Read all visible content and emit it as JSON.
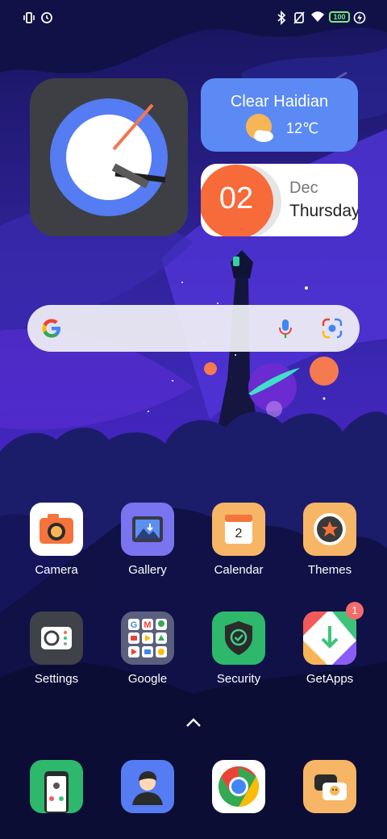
{
  "status_bar": {
    "icons": [
      "vibrate-icon",
      "alarm-icon",
      "bluetooth-icon",
      "no-sim-icon",
      "wifi-icon",
      "battery-icon",
      "charging-icon"
    ],
    "battery": "100"
  },
  "weather_widget": {
    "condition_location": "Clear Haidian",
    "temperature": "12℃",
    "icon": "partly-cloudy-icon"
  },
  "date_widget": {
    "day": "02",
    "month": "Dec",
    "weekday": "Thursday"
  },
  "search_bar": {
    "icons": [
      "google-logo",
      "mic-icon",
      "lens-icon"
    ]
  },
  "apps_row1": [
    {
      "label": "Camera",
      "icon": "camera-icon"
    },
    {
      "label": "Gallery",
      "icon": "gallery-icon"
    },
    {
      "label": "Calendar",
      "icon": "calendar-icon",
      "calendar_day": "2"
    },
    {
      "label": "Themes",
      "icon": "themes-icon"
    }
  ],
  "apps_row2": [
    {
      "label": "Settings",
      "icon": "settings-icon"
    },
    {
      "label": "Google",
      "icon": "google-folder-icon"
    },
    {
      "label": "Security",
      "icon": "security-icon"
    },
    {
      "label": "GetApps",
      "icon": "getapps-icon",
      "badge": "1"
    }
  ],
  "dock": [
    {
      "name": "Phone",
      "icon": "phone-icon"
    },
    {
      "name": "Contacts",
      "icon": "contacts-icon"
    },
    {
      "name": "Chrome",
      "icon": "chrome-icon"
    },
    {
      "name": "Messages",
      "icon": "messages-icon"
    }
  ],
  "colors": {
    "weather_bg": "#5b8af5",
    "date_accent": "#f76a3a",
    "wallpaper_top": "#1a1c6b"
  }
}
